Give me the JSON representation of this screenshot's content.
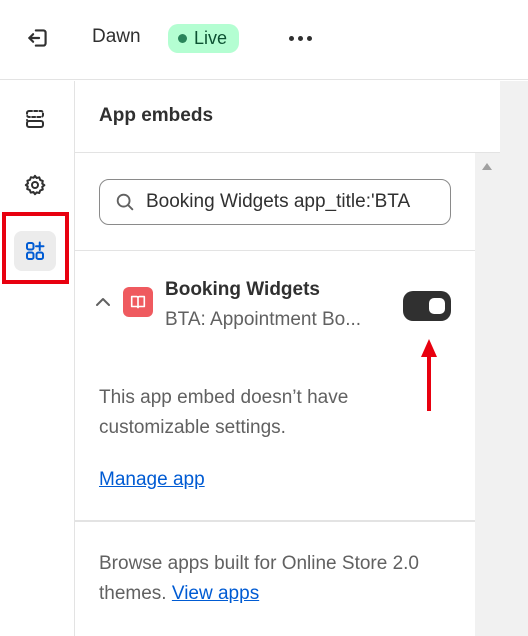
{
  "topbar": {
    "theme_name": "Dawn",
    "live_label": "Live"
  },
  "rail": {
    "items": [
      {
        "name": "sections",
        "icon": "sections-icon"
      },
      {
        "name": "theme-settings",
        "icon": "gear-icon"
      },
      {
        "name": "app-embeds",
        "icon": "apps-add-icon",
        "active": true
      }
    ]
  },
  "panel": {
    "title": "App embeds",
    "search_value": "Booking Widgets app_title:'BTA",
    "app": {
      "name": "Booking Widgets",
      "subtitle": "BTA: Appointment Bo...",
      "enabled": true,
      "note": "This app embed doesn’t have customizable settings.",
      "manage_label": "Manage app"
    },
    "browse": {
      "text": "Browse apps built for Online Store 2.0 themes.",
      "link_label": "View apps"
    }
  },
  "colors": {
    "highlight": "#e8000f",
    "live_bg": "#b4fed2",
    "link": "#005bd3",
    "toggle_on": "#303030",
    "app_logo": "#ef5a5f"
  }
}
